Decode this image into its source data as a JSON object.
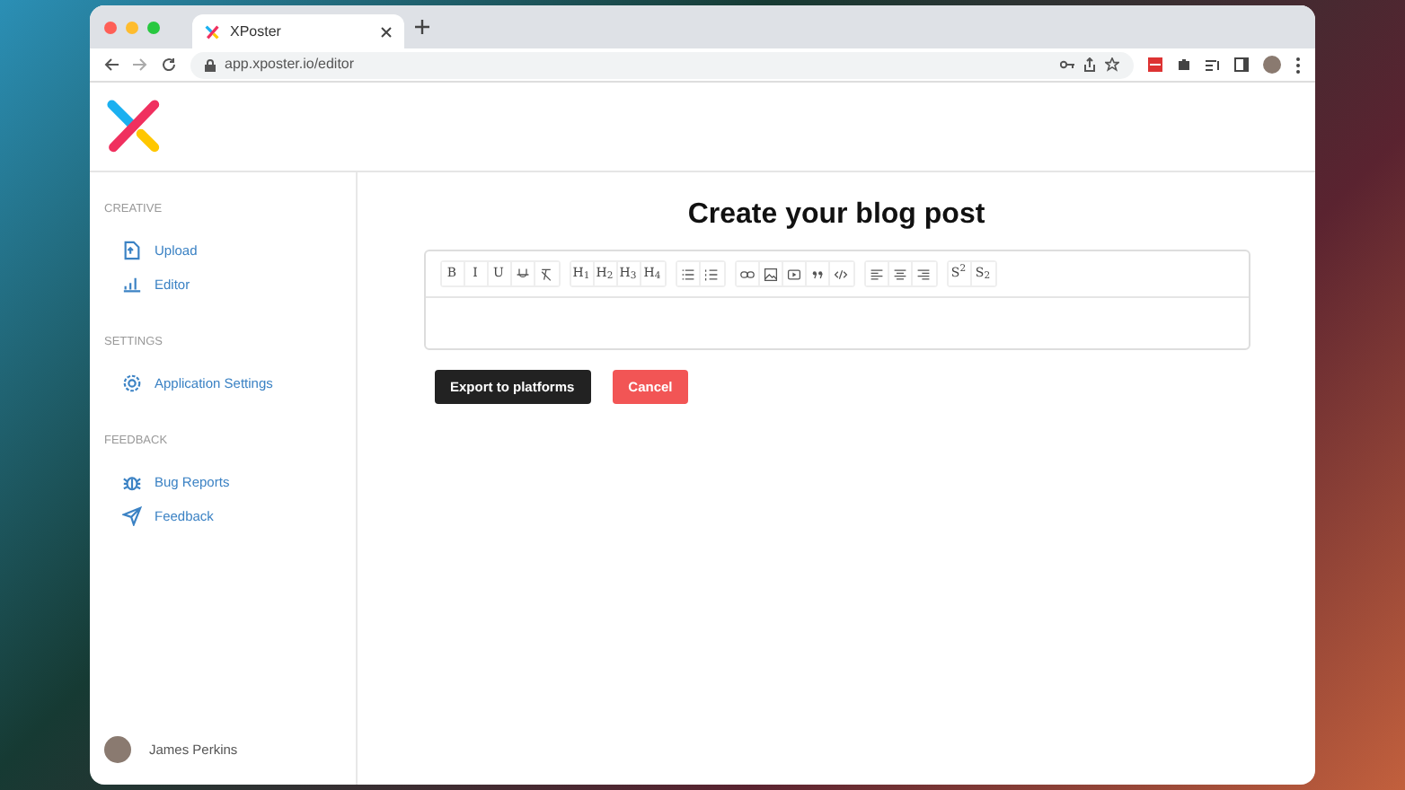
{
  "browser": {
    "tab_title": "XPoster",
    "url": "app.xposter.io/editor"
  },
  "sidebar": {
    "sections": [
      {
        "heading": "CREATIVE",
        "items": [
          {
            "label": "Upload"
          },
          {
            "label": "Editor"
          }
        ]
      },
      {
        "heading": "SETTINGS",
        "items": [
          {
            "label": "Application Settings"
          }
        ]
      },
      {
        "heading": "FEEDBACK",
        "items": [
          {
            "label": "Bug Reports"
          },
          {
            "label": "Feedback"
          }
        ]
      }
    ],
    "user": {
      "name": "James Perkins"
    }
  },
  "main": {
    "title": "Create your blog post",
    "toolbar_groups": [
      [
        {
          "kind": "text",
          "label": "B"
        },
        {
          "kind": "text",
          "label": "I"
        },
        {
          "kind": "text",
          "label": "U"
        },
        {
          "kind": "icon"
        },
        {
          "kind": "icon"
        }
      ],
      [
        {
          "kind": "text",
          "label": "H$_{1}$"
        },
        {
          "kind": "text",
          "label": "H$_{2}$"
        },
        {
          "kind": "text",
          "label": "H$_{3}$"
        },
        {
          "kind": "text",
          "label": "H$_{4}$"
        }
      ],
      [
        {
          "kind": "icon"
        },
        {
          "kind": "icon"
        }
      ],
      [
        {
          "kind": "icon"
        },
        {
          "kind": "icon"
        },
        {
          "kind": "icon"
        },
        {
          "kind": "icon"
        },
        {
          "kind": "icon"
        }
      ],
      [
        {
          "kind": "icon"
        },
        {
          "kind": "icon"
        },
        {
          "kind": "icon"
        }
      ],
      [
        {
          "kind": "text",
          "label": "S$^{2}$"
        },
        {
          "kind": "text",
          "label": "S$_{2}$"
        }
      ]
    ],
    "buttons": [
      {
        "label": "Export to platforms",
        "kind": "primary"
      },
      {
        "label": "Cancel",
        "kind": "danger"
      }
    ]
  }
}
